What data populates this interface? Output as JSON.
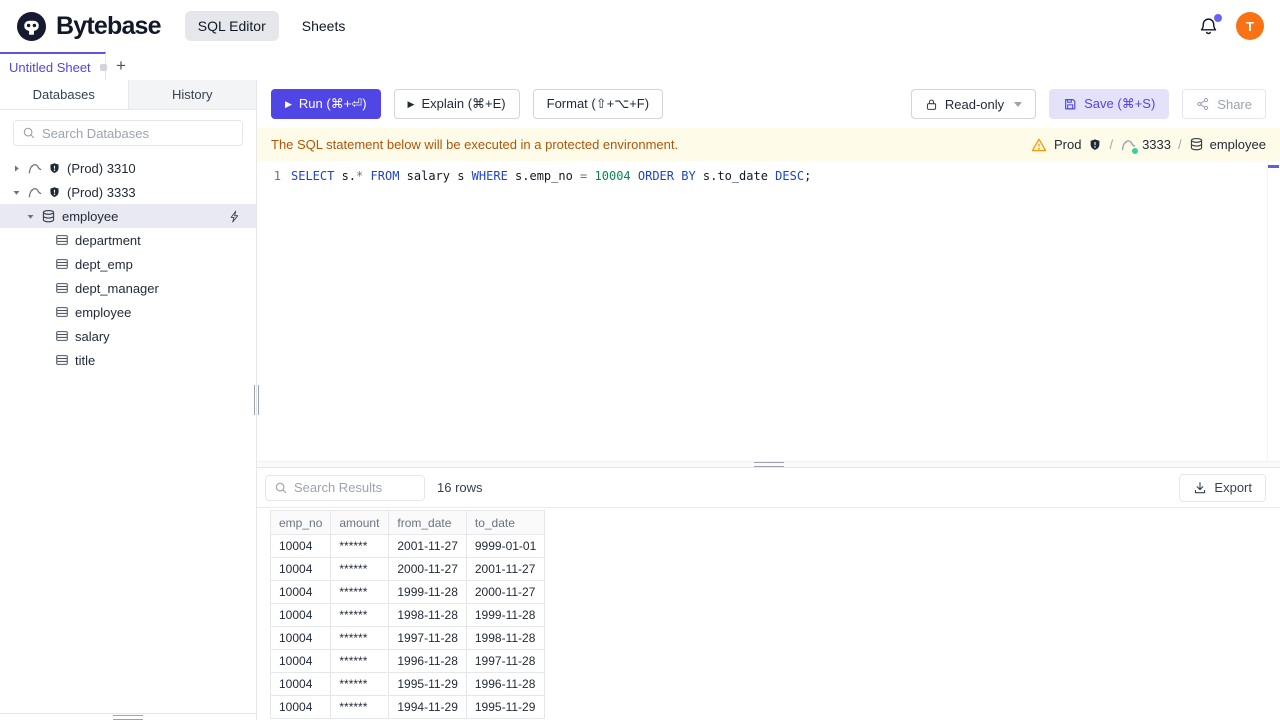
{
  "colors": {
    "accent_purple": "#4f46e5",
    "banner_bg": "#fefce8",
    "banner_text": "#b45309",
    "avatar_orange": "#f97316",
    "keyword_blue": "#1e45c8",
    "number_green": "#098658",
    "warning_yellow": "#f59e0b",
    "status_green": "#34d399"
  },
  "header": {
    "brand": "Bytebase",
    "nav": [
      {
        "label": "SQL Editor",
        "active": true
      },
      {
        "label": "Sheets",
        "active": false
      }
    ],
    "avatar_initial": "T"
  },
  "tabstrip": {
    "active_tab": "Untitled Sheet",
    "add_button": "+"
  },
  "sidebar": {
    "tabs": [
      {
        "label": "Databases",
        "active": true
      },
      {
        "label": "History",
        "active": false
      }
    ],
    "search_placeholder": "Search Databases",
    "tree": {
      "instances": [
        {
          "label": "(Prod) 3310",
          "expanded": false
        },
        {
          "label": "(Prod) 3333",
          "expanded": true,
          "databases": [
            {
              "label": "employee",
              "selected": true,
              "tables": [
                "department",
                "dept_emp",
                "dept_manager",
                "employee",
                "salary",
                "title"
              ]
            }
          ]
        }
      ]
    }
  },
  "toolbar": {
    "run": "Run (⌘+⏎)",
    "explain": "Explain (⌘+E)",
    "format": "Format (⇧+⌥+F)",
    "mode": "Read-only",
    "save": "Save (⌘+S)",
    "share": "Share"
  },
  "banner": {
    "message": "The SQL statement below will be executed in a protected environment.",
    "environment": "Prod",
    "separator": "/",
    "instance": "3333",
    "database": "employee"
  },
  "editor": {
    "line_number": "1",
    "sql": "SELECT s.* FROM salary s WHERE s.emp_no = 10004 ORDER BY s.to_date DESC;",
    "tokens": [
      {
        "t": "SELECT",
        "c": "kw"
      },
      {
        "t": " s."
      },
      {
        "t": "*",
        "c": "op"
      },
      {
        "t": " "
      },
      {
        "t": "FROM",
        "c": "kw"
      },
      {
        "t": " salary s "
      },
      {
        "t": "WHERE",
        "c": "kw"
      },
      {
        "t": " s.emp_no "
      },
      {
        "t": "=",
        "c": "op"
      },
      {
        "t": " "
      },
      {
        "t": "10004",
        "c": "num"
      },
      {
        "t": " "
      },
      {
        "t": "ORDER BY",
        "c": "kw"
      },
      {
        "t": " s.to_date "
      },
      {
        "t": "DESC",
        "c": "kw"
      },
      {
        "t": ";"
      }
    ]
  },
  "results": {
    "search_placeholder": "Search Results",
    "row_count": "16 rows",
    "export": "Export",
    "columns": [
      "emp_no",
      "amount",
      "from_date",
      "to_date"
    ],
    "rows": [
      [
        "10004",
        "******",
        "2001-11-27",
        "9999-01-01"
      ],
      [
        "10004",
        "******",
        "2000-11-27",
        "2001-11-27"
      ],
      [
        "10004",
        "******",
        "1999-11-28",
        "2000-11-27"
      ],
      [
        "10004",
        "******",
        "1998-11-28",
        "1999-11-28"
      ],
      [
        "10004",
        "******",
        "1997-11-28",
        "1998-11-28"
      ],
      [
        "10004",
        "******",
        "1996-11-28",
        "1997-11-28"
      ],
      [
        "10004",
        "******",
        "1995-11-29",
        "1996-11-28"
      ],
      [
        "10004",
        "******",
        "1994-11-29",
        "1995-11-29"
      ]
    ]
  }
}
